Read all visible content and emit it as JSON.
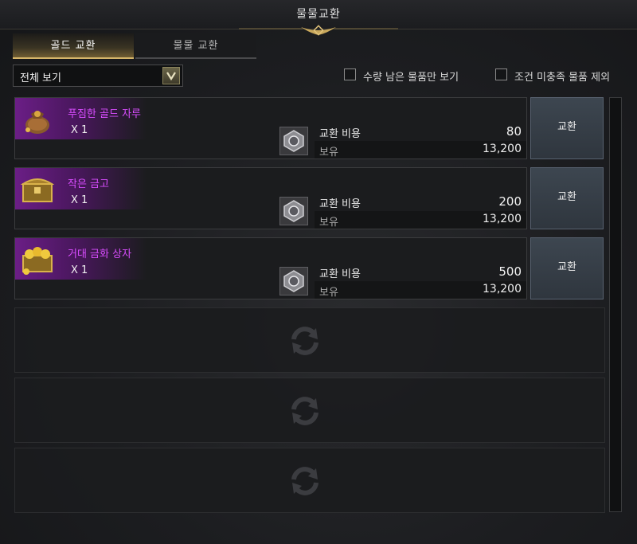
{
  "window": {
    "title": "물물교환"
  },
  "tabs": [
    {
      "label": "골드 교환",
      "active": true
    },
    {
      "label": "물물 교환",
      "active": false
    }
  ],
  "filter": {
    "selected": "전체 보기"
  },
  "checkboxes": [
    {
      "label": "수량 남은 물품만 보기",
      "checked": false
    },
    {
      "label": "조건 미충족 물품 제외",
      "checked": false
    }
  ],
  "items": [
    {
      "name": "푸짐한 골드 자루",
      "qty": "X 1",
      "icon": "gold-pouch-icon",
      "cost_label": "교환 비용",
      "cost": "80",
      "own_label": "보유",
      "own": "13,200",
      "button": "교환"
    },
    {
      "name": "작은 금고",
      "qty": "X 1",
      "icon": "small-chest-icon",
      "cost_label": "교환 비용",
      "cost": "200",
      "own_label": "보유",
      "own": "13,200",
      "button": "교환"
    },
    {
      "name": "거대 금화 상자",
      "qty": "X 1",
      "icon": "gold-coin-chest-icon",
      "cost_label": "교환 비용",
      "cost": "500",
      "own_label": "보유",
      "own": "13,200",
      "button": "교환"
    }
  ],
  "colors": {
    "item_name": "#d94dff",
    "tab_accent": "#d6b66a",
    "button_bg": "#3d4650"
  }
}
